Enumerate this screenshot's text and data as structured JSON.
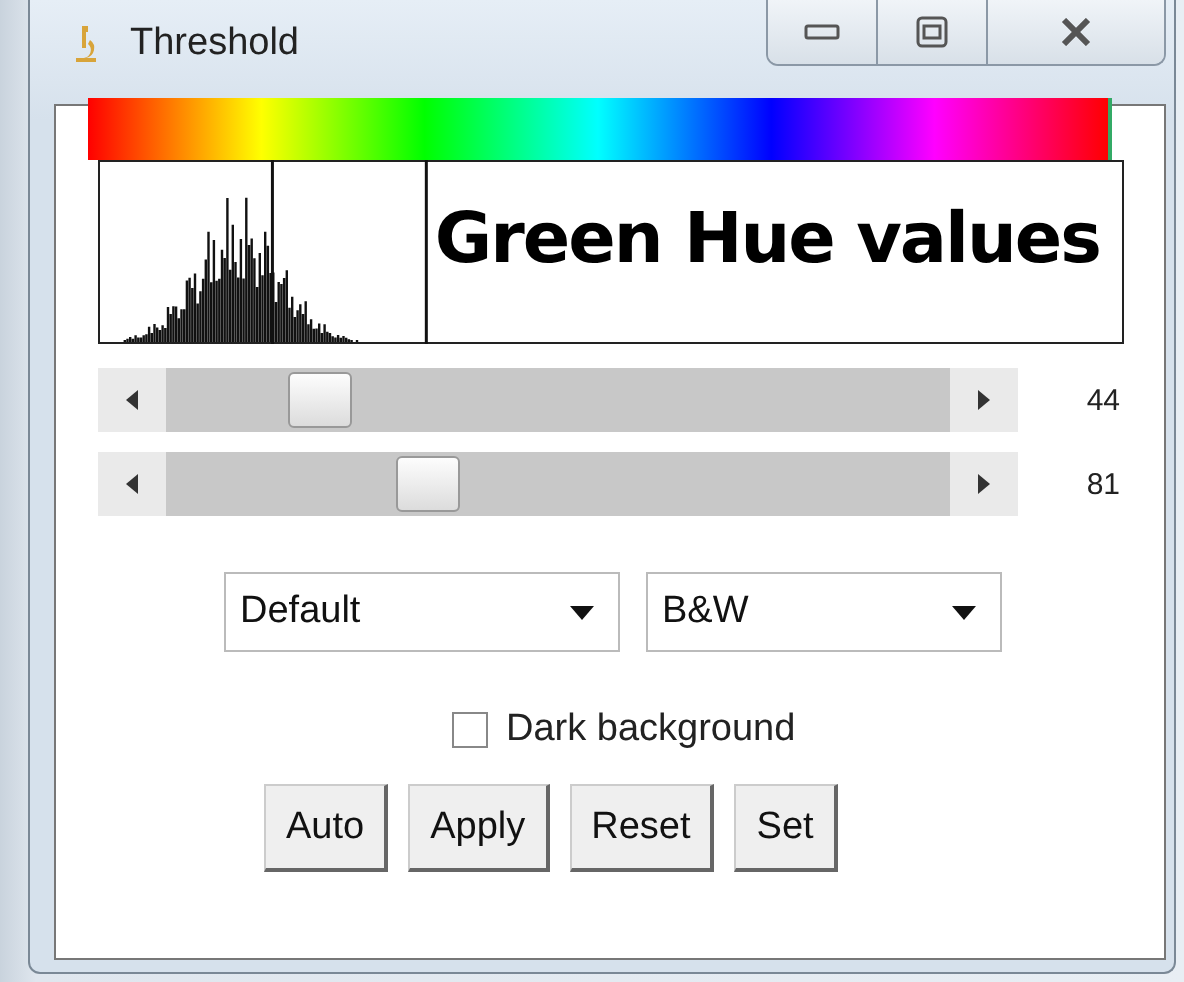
{
  "window": {
    "title": "Threshold"
  },
  "annotation": "Green Hue values",
  "sliders": [
    {
      "level": 0.17,
      "reading": "44"
    },
    {
      "level": 0.32,
      "reading": "81"
    }
  ],
  "dropdowns": [
    {
      "value": "Default"
    },
    {
      "value": "B&W"
    }
  ],
  "checkbox": {
    "label": "Dark background",
    "checked": false
  },
  "buttons": [
    "Auto",
    "Apply",
    "Reset",
    "Set"
  ]
}
